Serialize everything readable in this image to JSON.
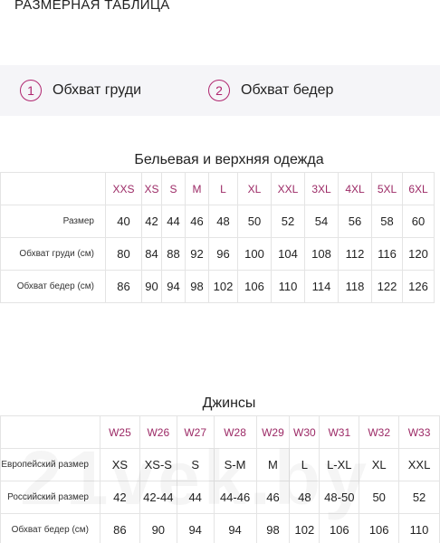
{
  "page": {
    "title": "РАЗМЕРНАЯ ТАБЛИЦА"
  },
  "legend": [
    {
      "num": "1",
      "label": "Обхват груди"
    },
    {
      "num": "2",
      "label": "Обхват бедер"
    }
  ],
  "underwear": {
    "title": "Бельевая и верхняя одежда",
    "headers": [
      "XXS",
      "XS",
      "S",
      "M",
      "L",
      "XL",
      "XXL",
      "3XL",
      "4XL",
      "5XL",
      "6XL"
    ],
    "rows": [
      {
        "label": "Размер",
        "values": [
          "40",
          "42",
          "44",
          "46",
          "48",
          "50",
          "52",
          "54",
          "56",
          "58",
          "60"
        ]
      },
      {
        "label": "Обхват груди (см)",
        "values": [
          "80",
          "84",
          "88",
          "92",
          "96",
          "100",
          "104",
          "108",
          "112",
          "116",
          "120"
        ]
      },
      {
        "label": "Обхват бедер (см)",
        "values": [
          "86",
          "90",
          "94",
          "98",
          "102",
          "106",
          "110",
          "114",
          "118",
          "122",
          "126"
        ]
      }
    ]
  },
  "jeans": {
    "title": "Джинсы",
    "headers": [
      "W25",
      "W26",
      "W27",
      "W28",
      "W29",
      "W30",
      "W31",
      "W32",
      "W33"
    ],
    "rows": [
      {
        "label": "Европейский размер",
        "values": [
          "XS",
          "XS-S",
          "S",
          "S-M",
          "M",
          "L",
          "L-XL",
          "XL",
          "XXL"
        ]
      },
      {
        "label": "Российский размер",
        "values": [
          "42",
          "42-44",
          "44",
          "44-46",
          "46",
          "48",
          "48-50",
          "50",
          "52"
        ]
      },
      {
        "label": "Обхват бедер (см)",
        "values": [
          "86",
          "90",
          "94",
          "94",
          "98",
          "102",
          "106",
          "106",
          "110"
        ]
      }
    ]
  },
  "watermark": {
    "text": "21vek.by"
  }
}
